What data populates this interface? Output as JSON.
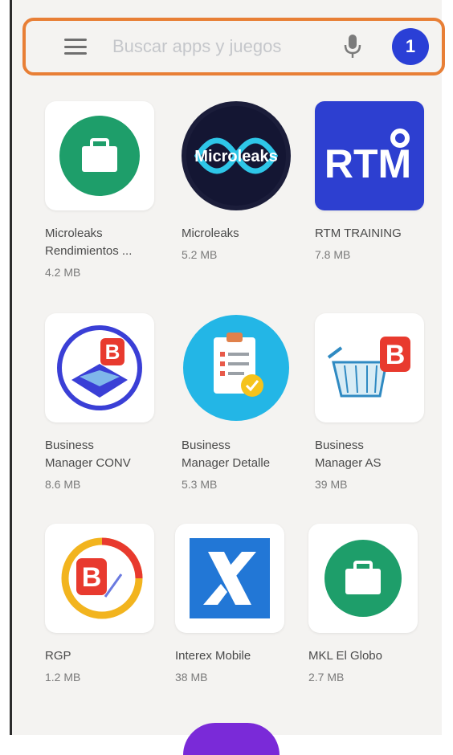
{
  "search": {
    "placeholder": "Buscar apps y juegos",
    "avatar_initial": "1"
  },
  "apps": [
    {
      "name_line1": "Microleaks",
      "name_line2": "Rendimientos ...",
      "size": "4.2 MB",
      "icon": "briefcase-icon"
    },
    {
      "name_line1": "Microleaks",
      "name_line2": "",
      "size": "5.2 MB",
      "icon": "microleaks-logo",
      "logo_text": "Microleaks"
    },
    {
      "name_line1": "RTM TRAINING",
      "name_line2": "",
      "size": "7.8 MB",
      "icon": "rtm-logo",
      "logo_text": "RTM"
    },
    {
      "name_line1": "Business",
      "name_line2": "Manager CONV",
      "size": "8.6 MB",
      "icon": "business-manager-conv-icon"
    },
    {
      "name_line1": "Business",
      "name_line2": "Manager Detalle",
      "size": "5.3 MB",
      "icon": "clipboard-check-icon"
    },
    {
      "name_line1": "Business",
      "name_line2": "Manager AS",
      "size": "39 MB",
      "icon": "shopping-basket-b-icon"
    },
    {
      "name_line1": "RGP",
      "name_line2": "",
      "size": "1.2 MB",
      "icon": "rgp-b-icon"
    },
    {
      "name_line1": "Interex Mobile",
      "name_line2": "",
      "size": "38 MB",
      "icon": "interex-x-icon"
    },
    {
      "name_line1": "MKL El Globo",
      "name_line2": "",
      "size": "2.7 MB",
      "icon": "briefcase-icon"
    }
  ],
  "colors": {
    "highlight": "#e87f36",
    "avatar": "#2a3fd6",
    "briefcase_green": "#1e9e6a",
    "rtm_blue": "#2d3fd0",
    "interex_blue": "#2277d6",
    "b_red": "#e83a2e"
  }
}
